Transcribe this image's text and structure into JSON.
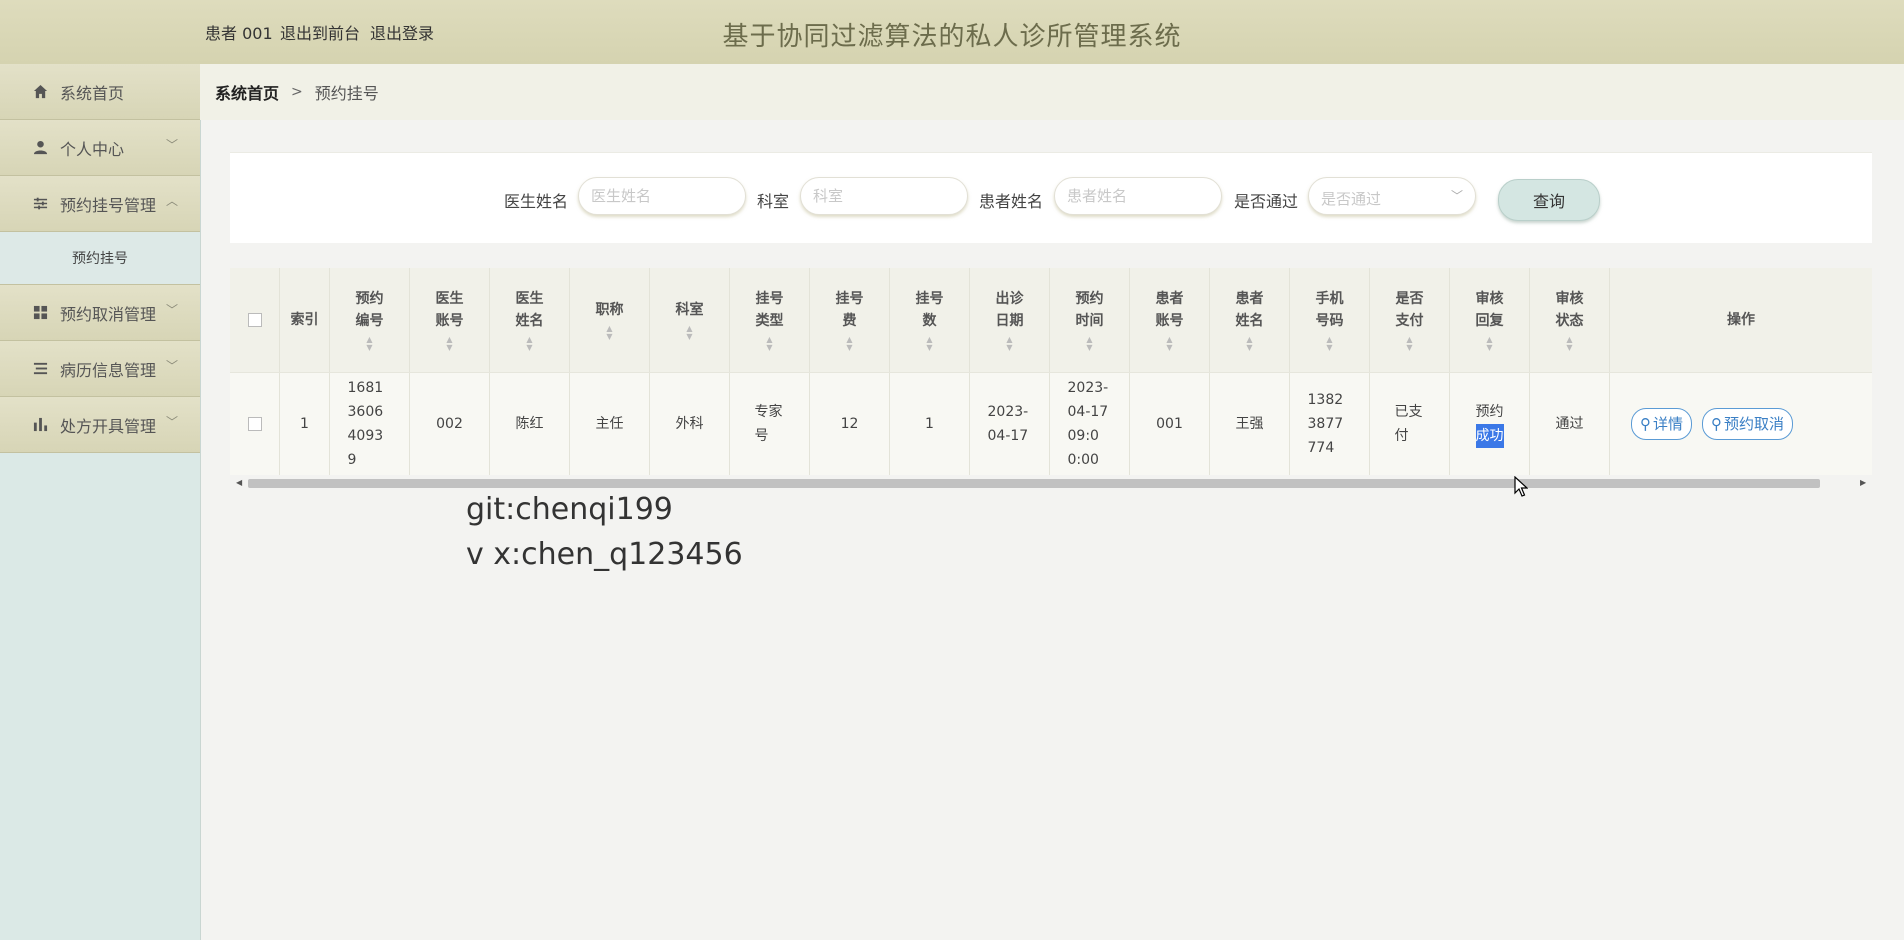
{
  "header": {
    "user": "患者 001",
    "link_front": "退出到前台",
    "link_logout": "退出登录",
    "title": "基于协同过滤算法的私人诊所管理系统"
  },
  "sidebar": {
    "items": [
      {
        "label": "系统首页",
        "icon": "home-icon"
      },
      {
        "label": "个人中心",
        "icon": "user-icon",
        "chevron": "﹀"
      },
      {
        "label": "预约挂号管理",
        "icon": "sliders-icon",
        "chevron": "︿"
      },
      {
        "label": "预约取消管理",
        "icon": "grid-icon",
        "chevron": "﹀"
      },
      {
        "label": "病历信息管理",
        "icon": "list-icon",
        "chevron": "﹀"
      },
      {
        "label": "处方开具管理",
        "icon": "bar-chart-icon",
        "chevron": "﹀"
      }
    ],
    "submenu": [
      "预约挂号"
    ]
  },
  "breadcrumb": {
    "home": "系统首页",
    "separator": ">",
    "current": "预约挂号"
  },
  "search": {
    "doctor_label": "医生姓名",
    "doctor_placeholder": "医生姓名",
    "dept_label": "科室",
    "dept_placeholder": "科室",
    "patient_label": "患者姓名",
    "patient_placeholder": "患者姓名",
    "approved_label": "是否通过",
    "approved_placeholder": "是否通过",
    "query_button": "查询"
  },
  "table": {
    "headers": [
      "索引",
      "预约编号",
      "医生账号",
      "医生姓名",
      "职称",
      "科室",
      "挂号类型",
      "挂号费",
      "挂号数",
      "出诊日期",
      "预约时间",
      "患者账号",
      "患者姓名",
      "手机号码",
      "是否支付",
      "审核回复",
      "审核状态",
      "操作"
    ],
    "rows": [
      {
        "index": "1",
        "booking_no": "1681360640939",
        "doctor_account": "002",
        "doctor_name": "陈红",
        "title": "主任",
        "dept": "外科",
        "reg_type": "专家号",
        "fee": "12",
        "count": "1",
        "visit_date": "2023-04-17",
        "booking_time": "2023-04-17 09:00:00",
        "patient_account": "001",
        "patient_name": "王强",
        "phone": "13823877774",
        "paid": "已支付",
        "reply_a": "预约",
        "reply_b": "成功",
        "status": "通过",
        "detail_btn": "详情",
        "cancel_btn": "预约取消"
      }
    ]
  },
  "watermark": {
    "line1": "git:chenqi199",
    "line2": "v x:chen_q123456"
  },
  "colors": {
    "header_bg": "#d9d7b7",
    "sidebar_bg": "#dbe9e6",
    "title_color": "#6c6c4c",
    "button_blue": "#3a7fc5",
    "selection": "#3b78e7"
  }
}
